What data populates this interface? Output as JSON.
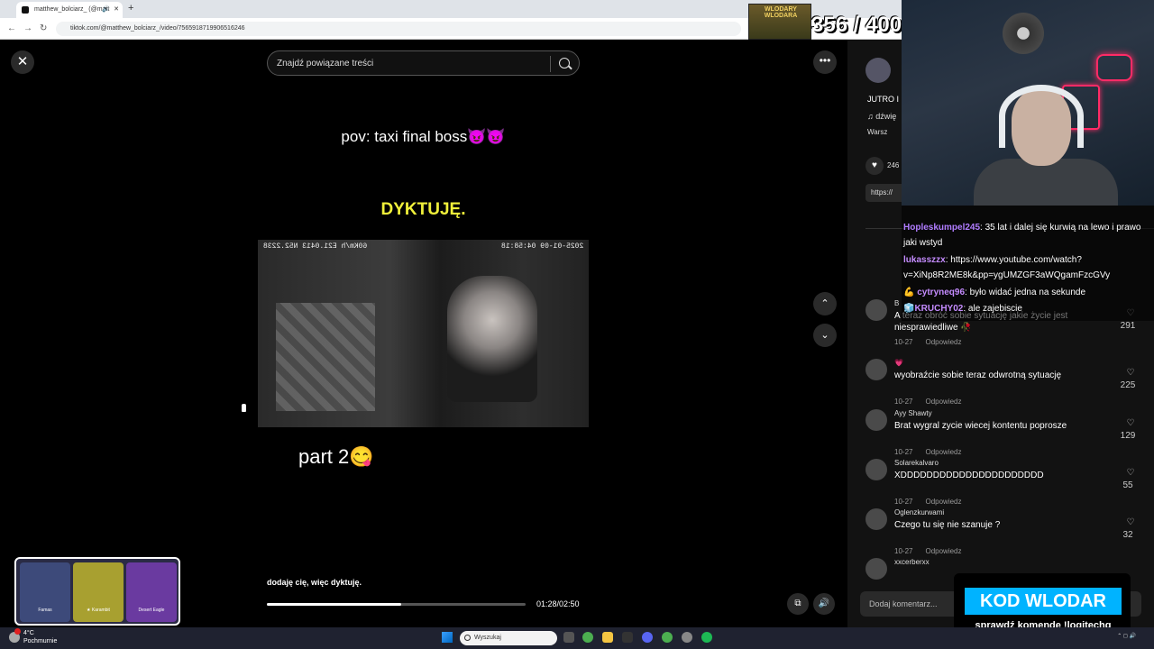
{
  "browser": {
    "tab_title": "matthew_bolciarz_ (@matt",
    "url": "tiktok.com/@matthew_bolciarz_/video/7565918719906516246"
  },
  "search": {
    "placeholder": "Znajdź powiązane treści"
  },
  "video": {
    "caption_top": "pov: taxi final boss😈😈",
    "caption_yellow": "DYKTUJĘ.",
    "timestamp": "2025-01-09 04:58:18",
    "gps": "60Km/h E21.0413 N52.2238",
    "part": "part 2😋",
    "subtitle": "dodaję cię, więc dyktuję.",
    "time": "01:28/02:50",
    "progress": 0.52
  },
  "panel": {
    "title": "JUTRO I",
    "sound": "♫  dźwię",
    "location": "Warsz",
    "likes": "246",
    "link": "https://",
    "comment_input": "Dodaj komentarz..."
  },
  "comments": [
    {
      "user": "B",
      "text": "A teraz obróć sobie sytuację jakie życie jest niesprawiedliwe 🥀",
      "date": "10-27",
      "reply": "Odpowiedz",
      "likes": "291"
    },
    {
      "user": "💗",
      "text": "wyobraźcie sobie teraz odwrotną sytuację",
      "date": "10-27",
      "reply": "Odpowiedz",
      "likes": "225"
    },
    {
      "user": "Ayy Shawty",
      "text": "Brat wygral zycie wiecej kontentu poprosze",
      "date": "10-27",
      "reply": "Odpowiedz",
      "likes": "129"
    },
    {
      "user": "Solarekalvaro",
      "text": "XDDDDDDDDDDDDDDDDDDDDDD",
      "date": "10-27",
      "reply": "Odpowiedz",
      "likes": "55"
    },
    {
      "user": "Oglenzkurwami",
      "text": "Czego tu się nie szanuje ?",
      "date": "10-27",
      "reply": "Odpowiedz",
      "likes": "32"
    },
    {
      "user": "xxcerberxx",
      "text": "",
      "date": "",
      "reply": "",
      "likes": ""
    }
  ],
  "stream": {
    "counter": "356 / 400",
    "counter_label": "WLODARY WLODARA",
    "chat": [
      {
        "nick": "Hopleskumpel245",
        "text": ": 35 lat i dalej się kurwią na lewo i prawo jaki wstyd",
        "color": "#b07cff"
      },
      {
        "nick": "lukasszzx",
        "text": ": https://www.youtube.com/watch?v=XiNp8R2ME8k&pp=ygUMZGF3aWQgamFzcGVy",
        "color": "#c58cff"
      },
      {
        "nick": "💪 cytryneq96",
        "text": ": było widać jedna na sekunde",
        "color": "#c58cff"
      },
      {
        "nick": "🧊KRUCHY02",
        "text": ": ale zajebiscie",
        "color": "#c58cff"
      }
    ],
    "promo_code": "KOD WLODAR",
    "promo_sub": "sprawdź komendę !logitechg",
    "cases": [
      "Famas",
      "★ Karambit",
      "Desert Eagle"
    ]
  },
  "taskbar": {
    "temp": "4°C",
    "weather": "Pochmurnie",
    "search": "Wyszukaj"
  }
}
